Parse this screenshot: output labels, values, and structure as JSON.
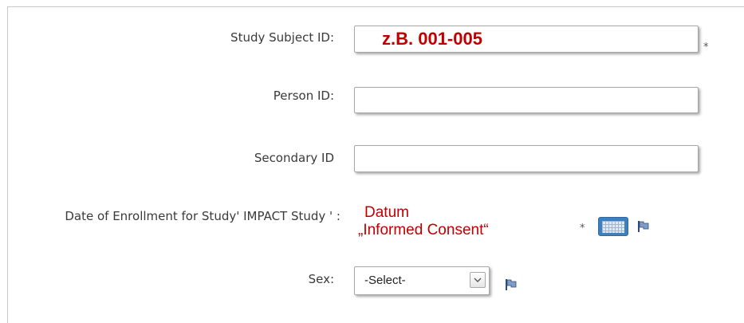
{
  "form": {
    "study_subject_id": {
      "label": "Study Subject ID:",
      "value": "z.B. 001-005",
      "required_mark": "*"
    },
    "person_id": {
      "label": "Person ID:",
      "value": ""
    },
    "secondary_id": {
      "label": "Secondary ID",
      "value": ""
    },
    "enrollment_date": {
      "label": "Date of Enrollment for Study' IMPACT Study ' :",
      "note_line1": "Datum",
      "note_line2": "„Informed Consent“",
      "required_mark": "*"
    },
    "sex": {
      "label": "Sex:",
      "selected": "-Select-"
    }
  },
  "icons": {
    "calendar": "calendar-icon",
    "flag": "flag-icon",
    "dropdown": "chevron-down-icon"
  },
  "colors": {
    "annotation": "#c00000",
    "accent": "#3e7fbf"
  }
}
